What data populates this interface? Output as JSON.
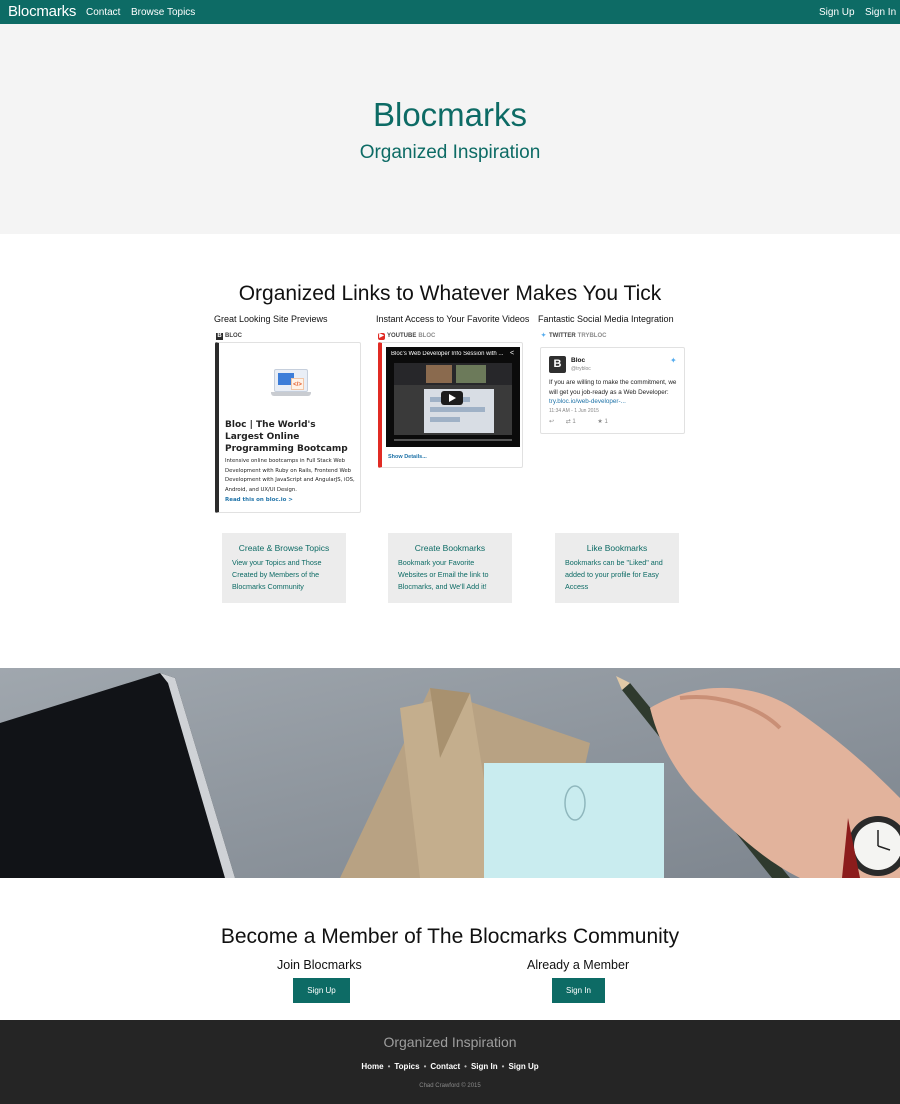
{
  "nav": {
    "brand": "Blocmarks",
    "links": [
      "Contact",
      "Browse Topics"
    ],
    "right_links": [
      "Sign Up",
      "Sign In"
    ]
  },
  "hero": {
    "title": "Blocmarks",
    "subtitle": "Organized Inspiration"
  },
  "features_section": {
    "title": "Organized Links to Whatever Makes You Tick",
    "columns": [
      {
        "heading": "Great Looking Site Previews",
        "provider": "BLOC",
        "provider_icon": "bloc-icon",
        "card": {
          "title": "Bloc | The World's Largest Online Programming Bootcamp",
          "description": "Intensive online bootcamps in Full Stack Web Development with Ruby on Rails, Frontend Web Development with JavaScript and AngularJS, iOS, Android, and UX/UI Design.",
          "link": "Read this on bloc.io >"
        }
      },
      {
        "heading": "Instant Access to Your Favorite Videos",
        "provider": "YOUTUBE",
        "provider_sub": "BLOC",
        "provider_icon": "youtube-icon",
        "card": {
          "video_title": "Bloc's Web Developer Info Session with ...",
          "link": "Show Details..."
        }
      },
      {
        "heading": "Fantastic Social Media Integration",
        "provider": "TWITTER",
        "provider_sub": "TRYBLOC",
        "provider_icon": "twitter-icon",
        "card": {
          "avatar_letter": "B",
          "name": "Bloc",
          "handle": "@trybloc",
          "text": "If you are willing to make the commitment, we will get you job-ready as a Web Developer:",
          "link": "try.bloc.io/web-developer-...",
          "time": "11:34 AM - 1 Jun 2015",
          "retweets": "1",
          "likes": "1"
        }
      }
    ],
    "boxes": [
      {
        "title": "Create & Browse Topics",
        "text": "View your Topics and Those Created by Members of the Blocmarks Community"
      },
      {
        "title": "Create Bookmarks",
        "text": "Bookmark your Favorite Websites or Email the link to Blocmarks, and We'll Add it!"
      },
      {
        "title": "Like Bookmarks",
        "text": "Bookmarks can be \"Liked\" and added to your profile for Easy Access"
      }
    ]
  },
  "member": {
    "title": "Become a Member of The Blocmarks Community",
    "join_label": "Join Blocmarks",
    "join_button": "Sign Up",
    "already_label": "Already a Member",
    "signin_button": "Sign In"
  },
  "footer": {
    "tagline": "Organized Inspiration",
    "links": [
      "Home",
      "Topics",
      "Contact",
      "Sign In",
      "Sign Up"
    ],
    "copyright": "Chad Crawford © 2015"
  },
  "colors": {
    "brand": "#0d6b65",
    "hero_bg": "#f4f4f4",
    "footer_bg": "#252525",
    "box_bg": "#ececec",
    "youtube_red": "#e12b24",
    "twitter_blue": "#55acee"
  }
}
